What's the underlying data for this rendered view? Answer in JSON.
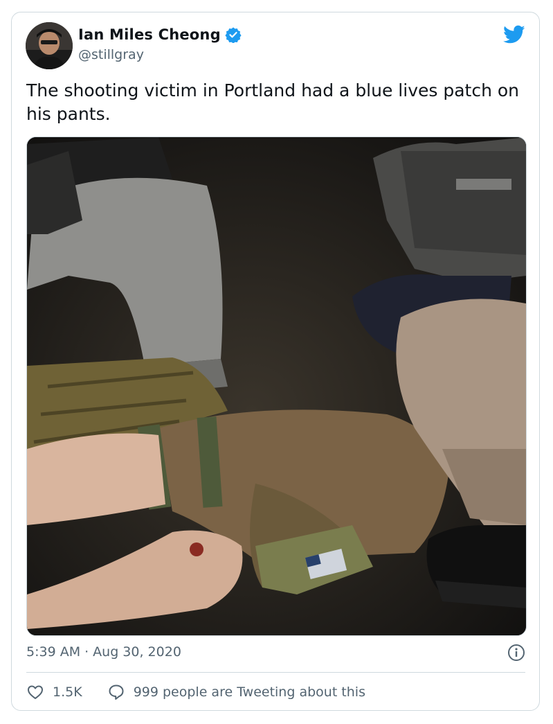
{
  "tweet": {
    "author": {
      "display_name": "Ian Miles Cheong",
      "handle": "@stillgray",
      "verified": true
    },
    "text": "The shooting victim in Portland had a blue lives patch on his pants.",
    "media": {
      "type": "photo"
    },
    "time": "5:39 AM",
    "date_separator": "·",
    "date": "Aug 30, 2020",
    "likes": "1.5K",
    "conversation": "999 people are Tweeting about this"
  },
  "icons": {
    "brand": "twitter-bird-icon",
    "verified": "verified-badge-icon",
    "info": "info-icon",
    "like": "heart-icon",
    "reply": "speech-bubble-icon"
  },
  "colors": {
    "brand_blue": "#1d9bf0",
    "text_primary": "#0f1419",
    "text_secondary": "#536471",
    "border": "#cfd9de"
  }
}
